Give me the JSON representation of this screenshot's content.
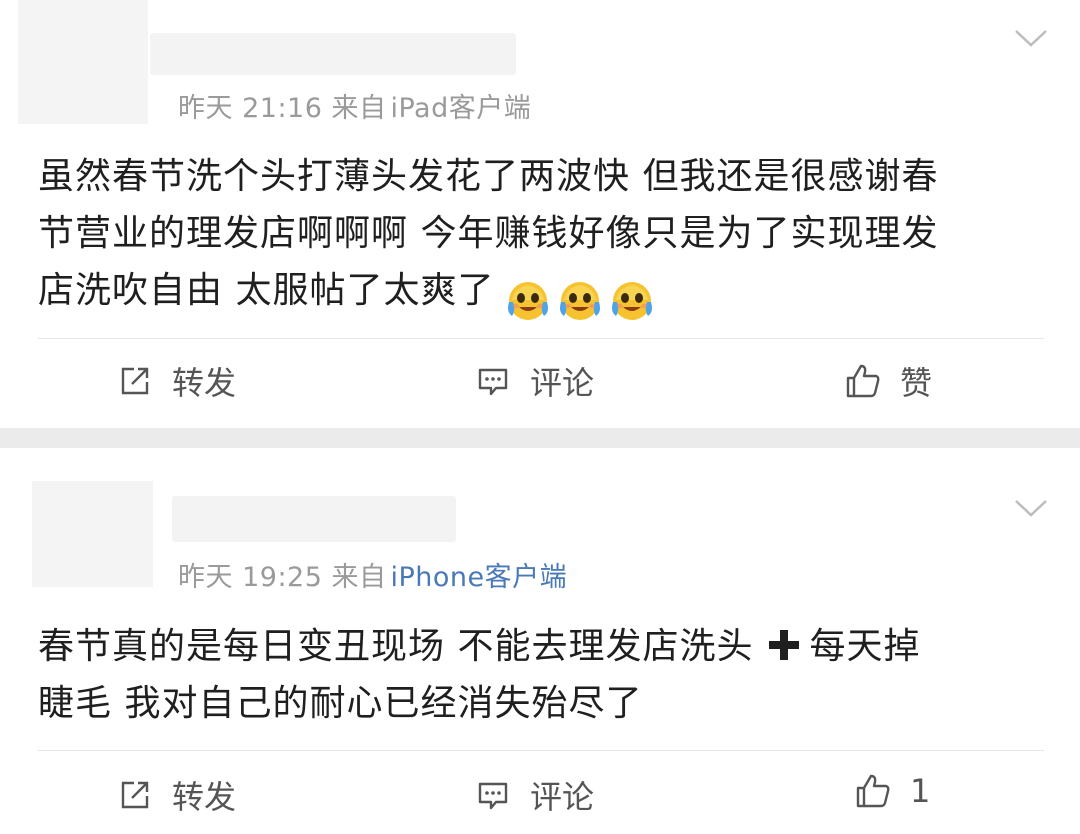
{
  "posts": [
    {
      "meta_time": "昨天 21:16 来自",
      "meta_source": "iPad客户端",
      "content_lines": [
        "虽然春节洗个头打薄头发花了两波快 但我还是很感谢春",
        "节营业的理发店啊啊啊 今年赚钱好像只是为了实现理发",
        "店洗吹自由 太服帖了太爽了"
      ],
      "emoji": [
        "crying-laugh-emoji",
        "crying-laugh-emoji",
        "crying-laugh-emoji"
      ],
      "actions": {
        "repost": "转发",
        "comment": "评论",
        "like": "赞"
      }
    },
    {
      "meta_time": "昨天 19:25 来自",
      "meta_source": "iPhone客户端",
      "content_line1_a": "春节真的是每日变丑现场 不能去理发店洗头",
      "content_line1_b": "每天掉",
      "content_line2": "睫毛 我对自己的耐心已经消失殆尽了",
      "actions": {
        "repost": "转发",
        "comment": "评论",
        "like": "1"
      }
    }
  ],
  "colors": {
    "source_link": "#4a79b8",
    "meta_gray": "#9a9a9a",
    "separator": "#ebebeb"
  },
  "icons": [
    "chevron-down-icon",
    "repost-icon",
    "comment-icon",
    "like-icon",
    "plus-icon"
  ]
}
